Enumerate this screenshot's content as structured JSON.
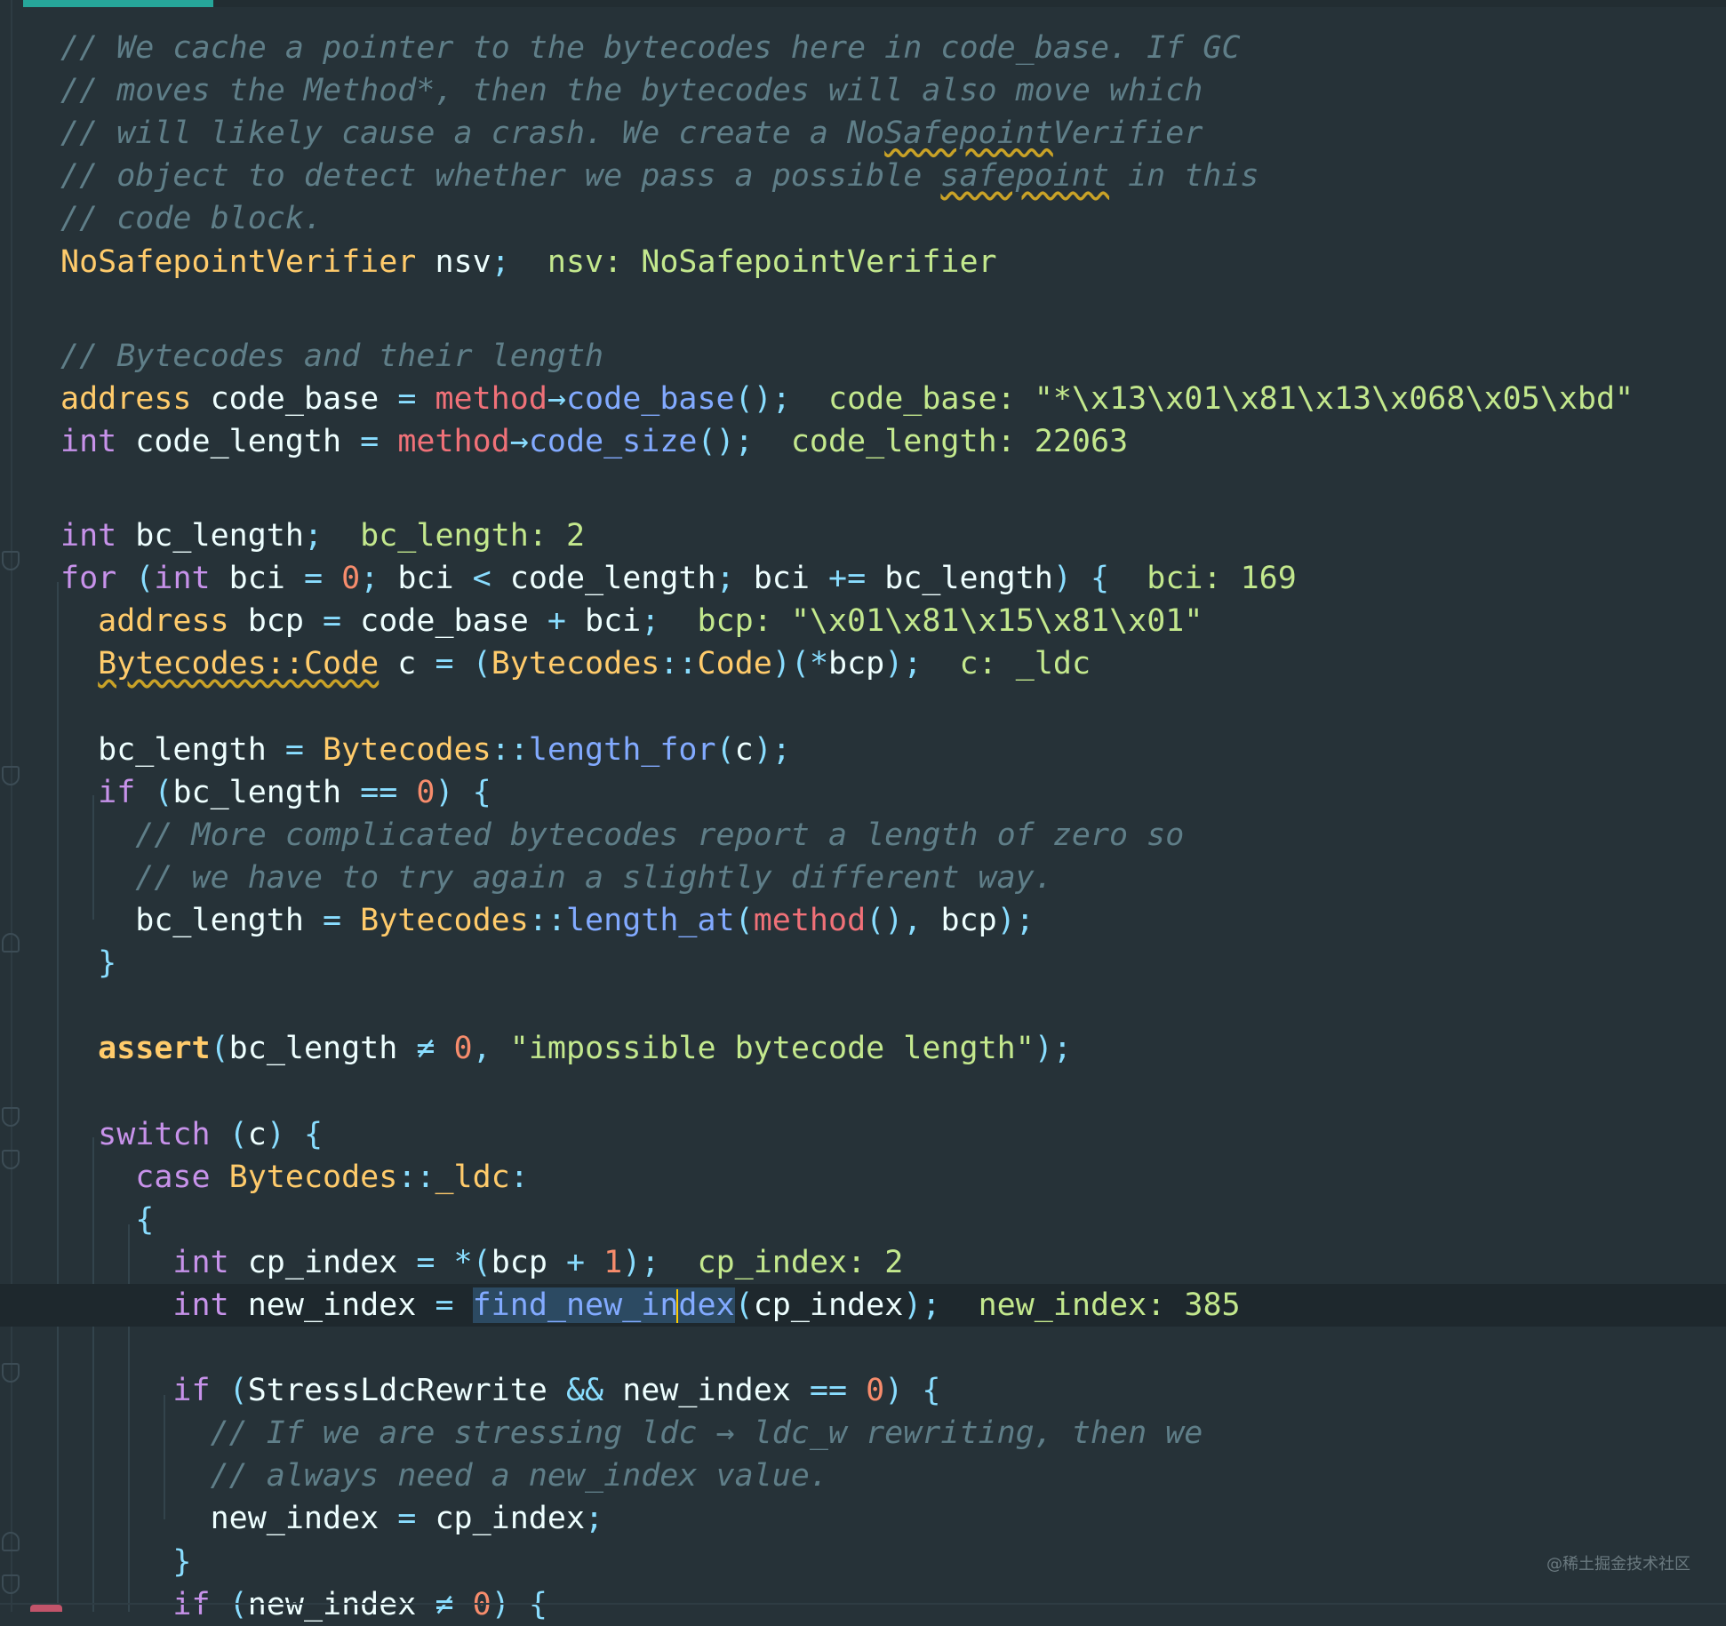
{
  "editor": {
    "language": "C++",
    "lines": [
      [
        {
          "t": "// We cache a pointer to the bytecodes here in code_base. If GC",
          "c": "cm"
        }
      ],
      [
        {
          "t": "// moves the Method*, then the bytecodes will also move which",
          "c": "cm"
        }
      ],
      [
        {
          "t": "// will likely cause a crash. We create a No",
          "c": "cm"
        },
        {
          "t": "Safepoint",
          "c": "cm warn"
        },
        {
          "t": "Verifier",
          "c": "cm"
        }
      ],
      [
        {
          "t": "// object to detect whether we pass a possible ",
          "c": "cm"
        },
        {
          "t": "safepoint",
          "c": "cm warn"
        },
        {
          "t": " in this",
          "c": "cm"
        }
      ],
      [
        {
          "t": "// code block.",
          "c": "cm"
        }
      ],
      [
        {
          "t": "NoSafepointVerifier",
          "c": "ty"
        },
        {
          "t": " nsv",
          "c": "id"
        },
        {
          "t": ";",
          "c": "pn"
        },
        {
          "t": "  nsv: NoSafepointVerifier",
          "c": "hint"
        }
      ],
      [],
      [
        {
          "t": "// Bytecodes and their length",
          "c": "cm"
        }
      ],
      [
        {
          "t": "address",
          "c": "ty"
        },
        {
          "t": " code_base ",
          "c": "id"
        },
        {
          "t": "=",
          "c": "op"
        },
        {
          "t": " ",
          "c": "id"
        },
        {
          "t": "method",
          "c": "me"
        },
        {
          "t": "→",
          "c": "op"
        },
        {
          "t": "code_base",
          "c": "fn"
        },
        {
          "t": "();",
          "c": "pn"
        },
        {
          "t": "  code_base: \"*\\x13\\x01\\x81\\x13\\x068\\x05\\xbd\"",
          "c": "hint"
        }
      ],
      [
        {
          "t": "int",
          "c": "kw"
        },
        {
          "t": " code_length ",
          "c": "id"
        },
        {
          "t": "=",
          "c": "op"
        },
        {
          "t": " ",
          "c": "id"
        },
        {
          "t": "method",
          "c": "me"
        },
        {
          "t": "→",
          "c": "op"
        },
        {
          "t": "code_size",
          "c": "fn"
        },
        {
          "t": "();",
          "c": "pn"
        },
        {
          "t": "  code_length: 22063",
          "c": "hint"
        }
      ],
      [],
      [
        {
          "t": "int",
          "c": "kw"
        },
        {
          "t": " bc_length",
          "c": "id"
        },
        {
          "t": ";",
          "c": "pn"
        },
        {
          "t": "  bc_length: 2",
          "c": "hint"
        }
      ],
      [
        {
          "t": "for",
          "c": "kw"
        },
        {
          "t": " (",
          "c": "pn"
        },
        {
          "t": "int",
          "c": "kw"
        },
        {
          "t": " bci ",
          "c": "id"
        },
        {
          "t": "=",
          "c": "op"
        },
        {
          "t": " ",
          "c": "id"
        },
        {
          "t": "0",
          "c": "nm"
        },
        {
          "t": ";",
          "c": "pn"
        },
        {
          "t": " bci ",
          "c": "id"
        },
        {
          "t": "<",
          "c": "op"
        },
        {
          "t": " code_length",
          "c": "id"
        },
        {
          "t": ";",
          "c": "pn"
        },
        {
          "t": " bci ",
          "c": "id"
        },
        {
          "t": "+=",
          "c": "op"
        },
        {
          "t": " bc_length",
          "c": "id"
        },
        {
          "t": ") {",
          "c": "pn"
        },
        {
          "t": "  bci: 169",
          "c": "hint"
        }
      ],
      [
        {
          "t": "  address",
          "c": "ty"
        },
        {
          "t": " bcp ",
          "c": "id"
        },
        {
          "t": "=",
          "c": "op"
        },
        {
          "t": " code_base ",
          "c": "id"
        },
        {
          "t": "+",
          "c": "op"
        },
        {
          "t": " bci",
          "c": "id"
        },
        {
          "t": ";",
          "c": "pn"
        },
        {
          "t": "  bcp: \"\\x01\\x81\\x15\\x81\\x01\"",
          "c": "hint"
        }
      ],
      [
        {
          "t": "  ",
          "c": "id"
        },
        {
          "t": "Bytecodes::Code",
          "c": "ty warn"
        },
        {
          "t": " c ",
          "c": "id"
        },
        {
          "t": "=",
          "c": "op"
        },
        {
          "t": " (",
          "c": "pn"
        },
        {
          "t": "Bytecodes",
          "c": "ty"
        },
        {
          "t": "::",
          "c": "op"
        },
        {
          "t": "Code",
          "c": "ty"
        },
        {
          "t": ")(",
          "c": "pn"
        },
        {
          "t": "*",
          "c": "op"
        },
        {
          "t": "bcp",
          "c": "id"
        },
        {
          "t": ");",
          "c": "pn"
        },
        {
          "t": "  c: _ldc",
          "c": "hint"
        }
      ],
      [],
      [
        {
          "t": "  bc_length ",
          "c": "id"
        },
        {
          "t": "=",
          "c": "op"
        },
        {
          "t": " ",
          "c": "id"
        },
        {
          "t": "Bytecodes",
          "c": "ty"
        },
        {
          "t": "::",
          "c": "op"
        },
        {
          "t": "length_for",
          "c": "fn"
        },
        {
          "t": "(",
          "c": "pn"
        },
        {
          "t": "c",
          "c": "id"
        },
        {
          "t": ");",
          "c": "pn"
        }
      ],
      [
        {
          "t": "  if",
          "c": "kw"
        },
        {
          "t": " (",
          "c": "pn"
        },
        {
          "t": "bc_length ",
          "c": "id"
        },
        {
          "t": "==",
          "c": "op"
        },
        {
          "t": " ",
          "c": "id"
        },
        {
          "t": "0",
          "c": "nm"
        },
        {
          "t": ") {",
          "c": "pn"
        }
      ],
      [
        {
          "t": "    // More complicated bytecodes report a length of zero so",
          "c": "cm"
        }
      ],
      [
        {
          "t": "    // we have to try again a slightly different way.",
          "c": "cm"
        }
      ],
      [
        {
          "t": "    bc_length ",
          "c": "id"
        },
        {
          "t": "=",
          "c": "op"
        },
        {
          "t": " ",
          "c": "id"
        },
        {
          "t": "Bytecodes",
          "c": "ty"
        },
        {
          "t": "::",
          "c": "op"
        },
        {
          "t": "length_at",
          "c": "fn"
        },
        {
          "t": "(",
          "c": "pn"
        },
        {
          "t": "method",
          "c": "me"
        },
        {
          "t": "(), ",
          "c": "pn"
        },
        {
          "t": "bcp",
          "c": "id"
        },
        {
          "t": ");",
          "c": "pn"
        }
      ],
      [
        {
          "t": "  }",
          "c": "pn"
        }
      ],
      [],
      [
        {
          "t": "  ",
          "c": "id"
        },
        {
          "t": "assert",
          "c": "as"
        },
        {
          "t": "(",
          "c": "pn"
        },
        {
          "t": "bc_length ",
          "c": "id"
        },
        {
          "t": "≠",
          "c": "op"
        },
        {
          "t": " ",
          "c": "id"
        },
        {
          "t": "0",
          "c": "nm"
        },
        {
          "t": ", ",
          "c": "pn"
        },
        {
          "t": "\"impossible bytecode length\"",
          "c": "st"
        },
        {
          "t": ");",
          "c": "pn"
        }
      ],
      [],
      [
        {
          "t": "  switch",
          "c": "kw"
        },
        {
          "t": " (",
          "c": "pn"
        },
        {
          "t": "c",
          "c": "id"
        },
        {
          "t": ") {",
          "c": "pn"
        }
      ],
      [
        {
          "t": "    case",
          "c": "kw"
        },
        {
          "t": " ",
          "c": "id"
        },
        {
          "t": "Bytecodes",
          "c": "ty"
        },
        {
          "t": "::",
          "c": "op"
        },
        {
          "t": "_ldc",
          "c": "ty"
        },
        {
          "t": ":",
          "c": "op"
        }
      ],
      [
        {
          "t": "    {",
          "c": "pn"
        }
      ],
      [
        {
          "t": "      int",
          "c": "kw"
        },
        {
          "t": " cp_index ",
          "c": "id"
        },
        {
          "t": "=",
          "c": "op"
        },
        {
          "t": " ",
          "c": "id"
        },
        {
          "t": "*",
          "c": "op"
        },
        {
          "t": "(",
          "c": "pn"
        },
        {
          "t": "bcp ",
          "c": "id"
        },
        {
          "t": "+",
          "c": "op"
        },
        {
          "t": " ",
          "c": "id"
        },
        {
          "t": "1",
          "c": "nm"
        },
        {
          "t": ");",
          "c": "pn"
        },
        {
          "t": "  cp_index: 2",
          "c": "hint"
        }
      ],
      [
        {
          "t": "      int",
          "c": "kw"
        },
        {
          "t": " new_index ",
          "c": "id"
        },
        {
          "t": "=",
          "c": "op"
        },
        {
          "t": " ",
          "c": "id"
        },
        {
          "t": "find_new_in",
          "c": "fn sel"
        },
        {
          "t": "",
          "c": "caret"
        },
        {
          "t": "dex",
          "c": "fn sel"
        },
        {
          "t": "(",
          "c": "pn"
        },
        {
          "t": "cp_index",
          "c": "id"
        },
        {
          "t": ");",
          "c": "pn"
        },
        {
          "t": "  new_index: 385",
          "c": "hint"
        }
      ],
      [],
      [
        {
          "t": "      if",
          "c": "kw"
        },
        {
          "t": " (",
          "c": "pn"
        },
        {
          "t": "StressLdcRewrite ",
          "c": "id"
        },
        {
          "t": "&&",
          "c": "op"
        },
        {
          "t": " new_index ",
          "c": "id"
        },
        {
          "t": "==",
          "c": "op"
        },
        {
          "t": " ",
          "c": "id"
        },
        {
          "t": "0",
          "c": "nm"
        },
        {
          "t": ") {",
          "c": "pn"
        }
      ],
      [
        {
          "t": "        // If we are stressing ldc → ldc_w rewriting, then we",
          "c": "cm"
        }
      ],
      [
        {
          "t": "        // always need a new_index value.",
          "c": "cm"
        }
      ],
      [
        {
          "t": "        new_index ",
          "c": "id"
        },
        {
          "t": "=",
          "c": "op"
        },
        {
          "t": " cp_index",
          "c": "id"
        },
        {
          "t": ";",
          "c": "pn"
        }
      ],
      [
        {
          "t": "      }",
          "c": "pn"
        }
      ],
      [
        {
          "t": "      if",
          "c": "kw"
        },
        {
          "t": " (",
          "c": "pn"
        },
        {
          "t": "new_index ",
          "c": "id"
        },
        {
          "t": "≠",
          "c": "op"
        },
        {
          "t": " ",
          "c": "id"
        },
        {
          "t": "0",
          "c": "nm"
        },
        {
          "t": ") {",
          "c": "pn"
        }
      ]
    ],
    "caret_line": 29
  },
  "watermark": "@稀土掘金技术社区",
  "colors": {
    "background": "#263238",
    "comment": "#5F7E88",
    "type": "#FFCB6B",
    "keyword": "#C792EA",
    "function": "#82AAFF",
    "operator": "#89DDFF",
    "number": "#F78C6C",
    "string": "#C3E88D",
    "inlay_hint": "#C3E88D",
    "caret": "#FFCC00"
  }
}
